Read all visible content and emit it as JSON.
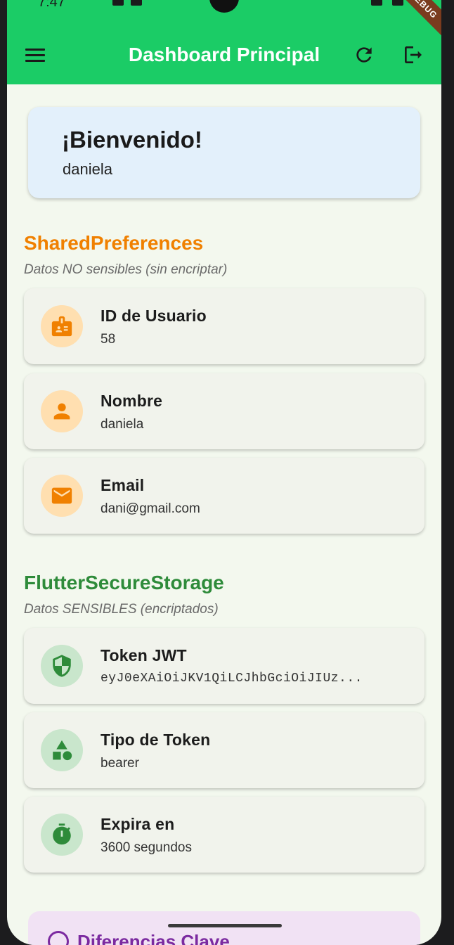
{
  "status": {
    "time": "7:47"
  },
  "appbar": {
    "title": "Dashboard Principal",
    "debug": "DEBUG"
  },
  "welcome": {
    "title": "¡Bienvenido!",
    "user": "daniela"
  },
  "shared_prefs": {
    "title": "SharedPreferences",
    "subtitle": "Datos NO sensibles (sin encriptar)",
    "color": "#f08000",
    "items": [
      {
        "icon": "badge-icon",
        "label": "ID de Usuario",
        "value": "58"
      },
      {
        "icon": "person-icon",
        "label": "Nombre",
        "value": "daniela"
      },
      {
        "icon": "email-icon",
        "label": "Email",
        "value": "dani@gmail.com"
      }
    ]
  },
  "secure_storage": {
    "title": "FlutterSecureStorage",
    "subtitle": "Datos SENSIBLES (encriptados)",
    "color": "#2e8b3a",
    "items": [
      {
        "icon": "shield-icon",
        "label": "Token JWT",
        "value": "eyJ0eXAiOiJKV1QiLCJhbGciOiJIUz..."
      },
      {
        "icon": "category-shapes-icon",
        "label": "Tipo de Token",
        "value": "bearer"
      },
      {
        "icon": "timer-icon",
        "label": "Expira en",
        "value": "3600 segundos"
      }
    ]
  },
  "bottom": {
    "title": "Diferencias Clave"
  }
}
